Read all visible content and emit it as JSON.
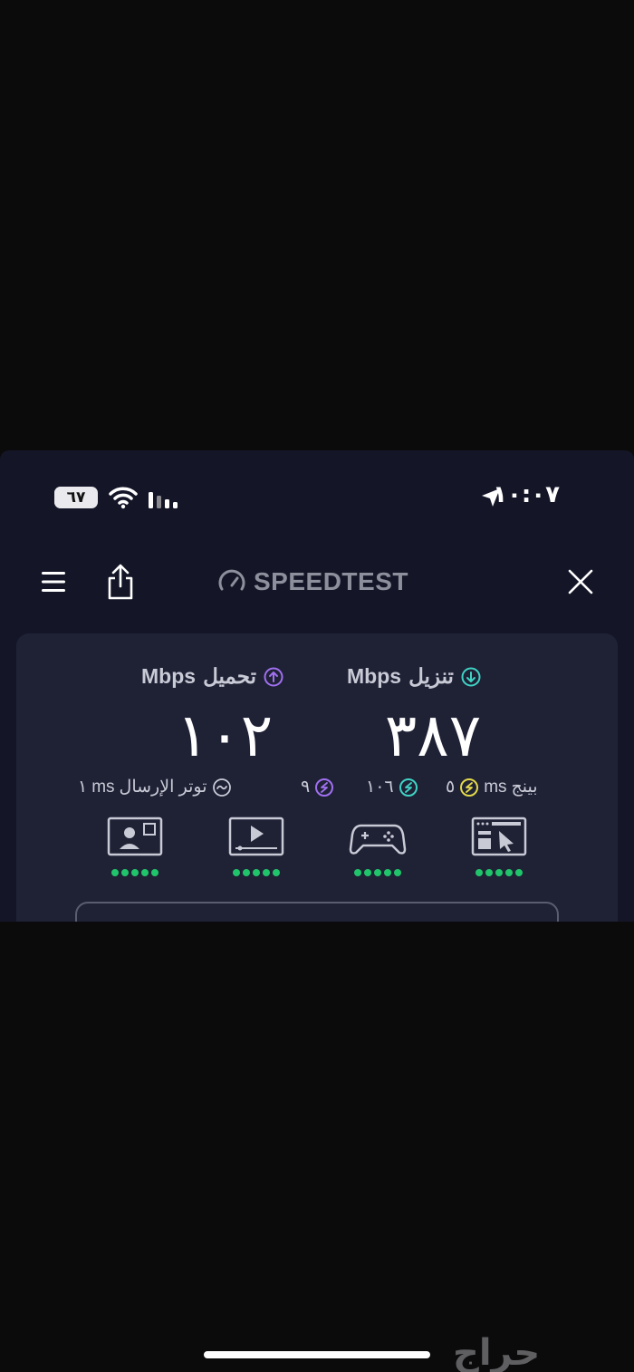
{
  "status_bar": {
    "time": "١٠:٠٧",
    "battery_text": "٦٧",
    "battery_level_percent": 67,
    "icons": [
      "location-arrow-icon",
      "wifi-icon",
      "cellular-signal-icon",
      "battery-icon"
    ]
  },
  "header": {
    "brand": "SPEEDTEST",
    "icons": [
      "menu-icon",
      "share-icon",
      "speedometer-icon",
      "close-icon"
    ]
  },
  "results": {
    "download": {
      "label": "تنزيل",
      "unit": "Mbps",
      "value": "٣٨٧",
      "icon": "arrow-down-circle-icon",
      "icon_color": "#3fd3c4"
    },
    "upload": {
      "label": "تحميل",
      "unit": "Mbps",
      "value": "١٠٢",
      "icon": "arrow-up-circle-icon",
      "icon_color": "#a070f0"
    }
  },
  "metrics": {
    "ping_label": "بينج",
    "ping_unit": "ms",
    "ping_idle": "٥",
    "ping_download": "١٠٦",
    "ping_upload": "٩",
    "jitter_label": "توتر الإرسال",
    "jitter_unit": "ms",
    "jitter_value": "١",
    "colors": {
      "idle": "#e2d84a",
      "download": "#3fd3c4",
      "upload": "#a070f0"
    }
  },
  "quality": [
    {
      "name": "video-call-icon",
      "rating": 5
    },
    {
      "name": "video-streaming-icon",
      "rating": 5
    },
    {
      "name": "gaming-icon",
      "rating": 5
    },
    {
      "name": "web-browsing-icon",
      "rating": 5
    }
  ],
  "watermark": "حراج"
}
